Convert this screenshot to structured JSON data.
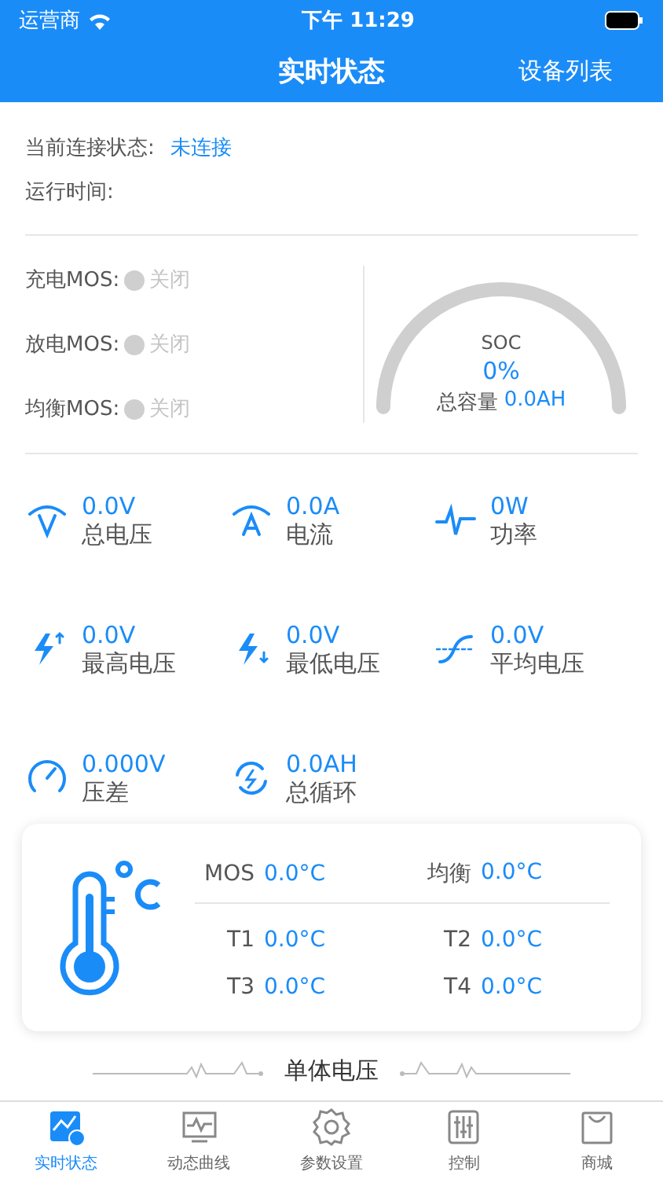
{
  "status_bar": {
    "carrier": "运营商",
    "time": "下午 11:29"
  },
  "header": {
    "title": "实时状态",
    "action": "设备列表"
  },
  "connection": {
    "label": "当前连接状态:",
    "value": "未连接",
    "runtime_label": "运行时间:"
  },
  "mos": [
    {
      "label": "充电MOS:",
      "state": "关闭",
      "on": false
    },
    {
      "label": "放电MOS:",
      "state": "关闭",
      "on": false
    },
    {
      "label": "均衡MOS:",
      "state": "关闭",
      "on": false
    }
  ],
  "soc": {
    "label": "SOC",
    "value": "0%",
    "capacity_label": "总容量",
    "capacity": "0.0AH"
  },
  "stats": [
    {
      "kind": "voltage",
      "value": "0.0V",
      "label": "总电压"
    },
    {
      "kind": "current",
      "value": "0.0A",
      "label": "电流"
    },
    {
      "kind": "power",
      "value": "0W",
      "label": "功率"
    },
    {
      "kind": "max",
      "value": "0.0V",
      "label": "最高电压"
    },
    {
      "kind": "min",
      "value": "0.0V",
      "label": "最低电压"
    },
    {
      "kind": "avg",
      "value": "0.0V",
      "label": "平均电压"
    },
    {
      "kind": "diff",
      "value": "0.000V",
      "label": "压差"
    },
    {
      "kind": "cycle",
      "value": "0.0AH",
      "label": "总循环"
    }
  ],
  "temperatures": {
    "top": [
      {
        "label": "MOS",
        "value": "0.0°C"
      },
      {
        "label": "均衡",
        "value": "0.0°C"
      }
    ],
    "sensors": [
      {
        "label": "T1",
        "value": "0.0°C"
      },
      {
        "label": "T2",
        "value": "0.0°C"
      },
      {
        "label": "T3",
        "value": "0.0°C"
      },
      {
        "label": "T4",
        "value": "0.0°C"
      }
    ]
  },
  "section_title": "单体电压",
  "tabs": [
    {
      "kind": "status",
      "label": "实时状态",
      "selected": true
    },
    {
      "kind": "curve",
      "label": "动态曲线",
      "selected": false
    },
    {
      "kind": "settings",
      "label": "参数设置",
      "selected": false
    },
    {
      "kind": "control",
      "label": "控制",
      "selected": false
    },
    {
      "kind": "shop",
      "label": "商城",
      "selected": false
    }
  ]
}
